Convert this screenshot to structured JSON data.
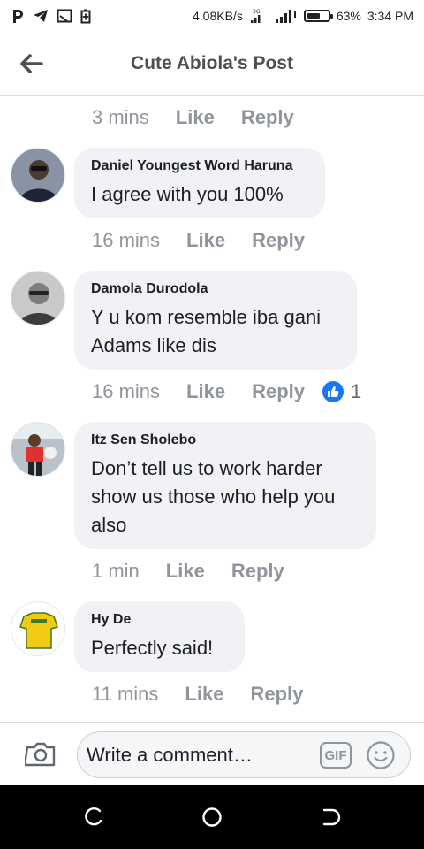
{
  "status_bar": {
    "left_icons": [
      "p-app-icon",
      "telegram-icon",
      "cast-icon",
      "battery-saver-icon"
    ],
    "speed": "4.08KB/s",
    "network_type": "3G",
    "battery_percent": "63%",
    "battery_level": 0.63,
    "time": "3:34 PM"
  },
  "header": {
    "title": "Cute Abiola's Post",
    "back_icon": "arrow-left-icon"
  },
  "top_meta": {
    "time": "3 mins",
    "like_label": "Like",
    "reply_label": "Reply"
  },
  "comments": [
    {
      "author": "Daniel Youngest Word Haruna",
      "text": "I agree with you 100%",
      "time": "16 mins",
      "like_label": "Like",
      "reply_label": "Reply"
    },
    {
      "author": "Damola Durodola",
      "text": "Y u kom resemble iba gani Adams like dis",
      "time": "16 mins",
      "like_label": "Like",
      "reply_label": "Reply",
      "reaction_count": "1",
      "reaction_icon": "thumbs-up-icon"
    },
    {
      "author": "Itz Sen Sholebo",
      "text": "Don’t tell us to work harder show us those who help you also",
      "time": "1 min",
      "like_label": "Like",
      "reply_label": "Reply"
    },
    {
      "author": "Hy De",
      "text": "Perfectly said!",
      "time": "11 mins",
      "like_label": "Like",
      "reply_label": "Reply"
    }
  ],
  "composer": {
    "placeholder": "Write a comment…",
    "gif_label": "GIF",
    "camera_icon": "camera-icon",
    "emoji_icon": "smiley-icon"
  },
  "navbar": {
    "icons": [
      "recents-icon",
      "home-icon",
      "back-icon"
    ]
  },
  "colors": {
    "bubble": "#f0f2f5",
    "meta_text": "#90949c",
    "like_blue": "#1877f2",
    "divider": "#dadde1"
  }
}
